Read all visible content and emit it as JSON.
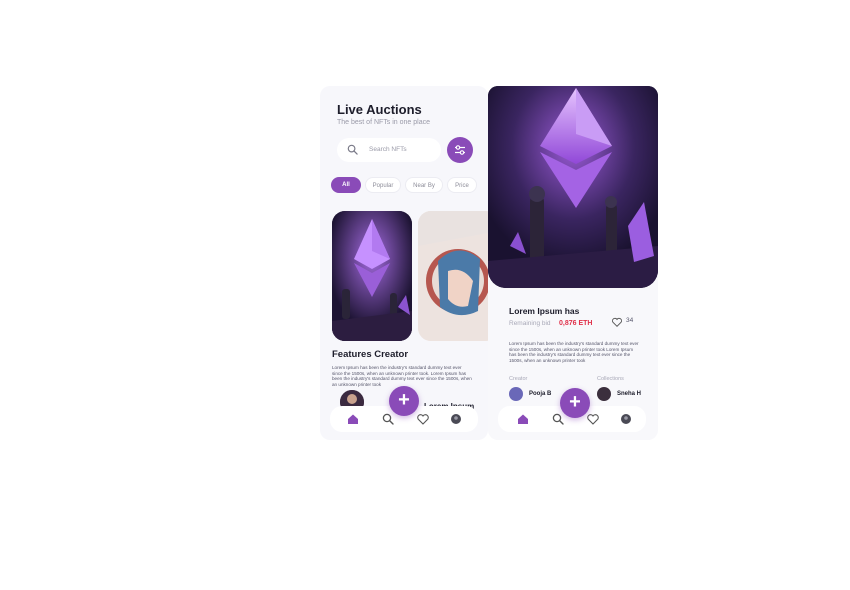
{
  "list_screen": {
    "title": "Live Auctions",
    "subtitle": "The best of NFTs in one place",
    "search_placeholder": "Search NFTs",
    "filters": [
      "All",
      "Popular",
      "Near By",
      "Price"
    ],
    "active_filter": "All",
    "section_title": "Features Creator",
    "section_text": "Lorem Ipsum has been the industry's standard dummy text ever since the 1500s, when an unknown printer took. Lorem Ipsum has been the industry's standard dummy text ever since the 1500s, when an unknown printer took",
    "creator_name": "Lorem Ipsum has",
    "fab_label": "+"
  },
  "detail_screen": {
    "title": "Lorem Ipsum has",
    "bid_label": "Remaining bid",
    "bid_price": "0,876 ETH",
    "likes": "34",
    "description": "Lorem Ipsum has been the industry's standard dummy text ever since the 1500s, when an unknown printer took Lorem Ipsum has been the industry's standard dummy text ever since the 1500s, when an unknown printer took",
    "creator_label": "Creator",
    "collection_label": "Collections",
    "creator_name": "Pooja B",
    "collection_name": "Sneha H",
    "fab_label": "+"
  },
  "icons": [
    "search-icon",
    "filter-icon",
    "home-icon",
    "heart-icon",
    "profile-icon",
    "plus-icon"
  ],
  "colors": {
    "accent": "#8a4bb8",
    "price": "#e0314a",
    "background": "#f7f7fb"
  }
}
